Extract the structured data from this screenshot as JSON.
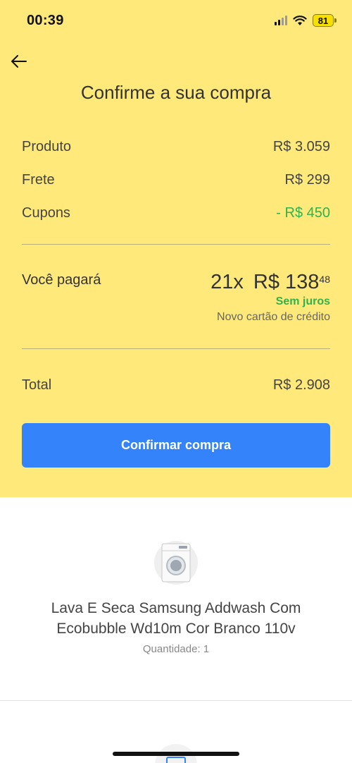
{
  "status_bar": {
    "time": "00:39",
    "battery": "81"
  },
  "header": {
    "title": "Confirme a sua compra"
  },
  "summary": {
    "rows": [
      {
        "label": "Produto",
        "value": "R$ 3.059"
      },
      {
        "label": "Frete",
        "value": "R$ 299"
      },
      {
        "label": "Cupons",
        "value": "- R$ 450"
      }
    ],
    "payment": {
      "label": "Você pagará",
      "installments": "21x",
      "amount_main": "R$ 138",
      "amount_cents": "48",
      "interest": "Sem juros",
      "method": "Novo cartão de crédito"
    },
    "total": {
      "label": "Total",
      "value": "R$ 2.908"
    }
  },
  "actions": {
    "confirm_label": "Confirmar compra"
  },
  "product": {
    "name": "Lava E Seca Samsung Addwash Com Ecobubble Wd10m Cor Branco 110v",
    "quantity": "Quantidade: 1"
  },
  "colors": {
    "background": "#ffe97a",
    "button": "#3483fa",
    "green": "#2fb34e"
  }
}
